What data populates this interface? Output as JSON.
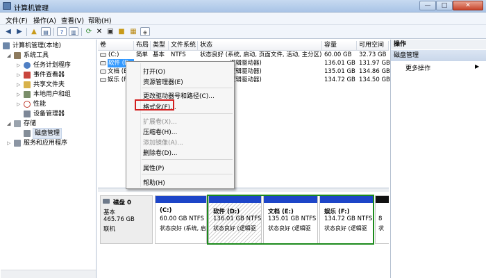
{
  "window": {
    "title": "计算机管理",
    "min": "—",
    "max": "□",
    "close": "✕"
  },
  "menu": [
    "文件(F)",
    "操作(A)",
    "查看(V)",
    "帮助(H)"
  ],
  "toolbar": [
    "back-icon",
    "forward-icon",
    "up-folder-icon",
    "show-tree-icon",
    "help-icon",
    "show-pane-icon",
    "refresh-icon",
    "delete-icon",
    "export-icon",
    "folder-open-icon",
    "properties-icon"
  ],
  "tree": {
    "root": "计算机管理(本地)",
    "system_tools": "系统工具",
    "task_scheduler": "任务计划程序",
    "event_viewer": "事件查看器",
    "shared_folders": "共享文件夹",
    "local_users": "本地用户和组",
    "performance": "性能",
    "device_manager": "设备管理器",
    "storage": "存储",
    "disk_management": "磁盘管理",
    "services": "服务和应用程序"
  },
  "columns": [
    "卷",
    "布局",
    "类型",
    "文件系统",
    "状态",
    "容量",
    "可用空间"
  ],
  "volumes": [
    {
      "name": "(C:)",
      "layout": "简单",
      "type": "基本",
      "fs": "NTFS",
      "status": "状态良好 (系统, 启动, 页面文件, 活动, 主分区)",
      "capacity": "60.00 GB",
      "free": "32.73 GB"
    },
    {
      "name": "软件 (D:",
      "layout": "",
      "type": "",
      "fs": "",
      "status": "逻辑驱动器)",
      "capacity": "136.01 GB",
      "free": "131.97 GB"
    },
    {
      "name": "文档 (E:",
      "layout": "",
      "type": "",
      "fs": "",
      "status": "逻辑驱动器)",
      "capacity": "135.01 GB",
      "free": "134.86 GB"
    },
    {
      "name": "娱乐 (F:",
      "layout": "",
      "type": "",
      "fs": "",
      "status": "逻辑驱动器)",
      "capacity": "134.72 GB",
      "free": "134.50 GB"
    }
  ],
  "context_menu": {
    "open": "打开(O)",
    "explorer": "资源管理器(E)",
    "change_letter": "更改驱动器号和路径(C)...",
    "format": "格式化(F)...",
    "extend": "扩展卷(X)...",
    "shrink": "压缩卷(H)...",
    "mirror": "添加镜像(A)...",
    "delete": "删除卷(D)...",
    "properties": "属性(P)",
    "help": "帮助(H)"
  },
  "disk": {
    "name": "磁盘 0",
    "type": "基本",
    "size": "465.76 GB",
    "state": "联机",
    "partitions": [
      {
        "label": "(C:)",
        "size": "60.00 GB NTFS",
        "status": "状态良好 (系统, 启动"
      },
      {
        "label": "软件 (D:)",
        "size": "136.01 GB NTFS",
        "status": "状态良好 (逻辑驱"
      },
      {
        "label": "文档 (E:)",
        "size": "135.01 GB NTFS",
        "status": "状态良好 (逻辑驱"
      },
      {
        "label": "娱乐 (F:)",
        "size": "134.72 GB NTFS",
        "status": "状态良好 (逻辑驱"
      },
      {
        "label": "8",
        "size": "",
        "status": "状"
      }
    ]
  },
  "actions": {
    "header": "操作",
    "section": "磁盘管理",
    "more": "更多操作"
  }
}
